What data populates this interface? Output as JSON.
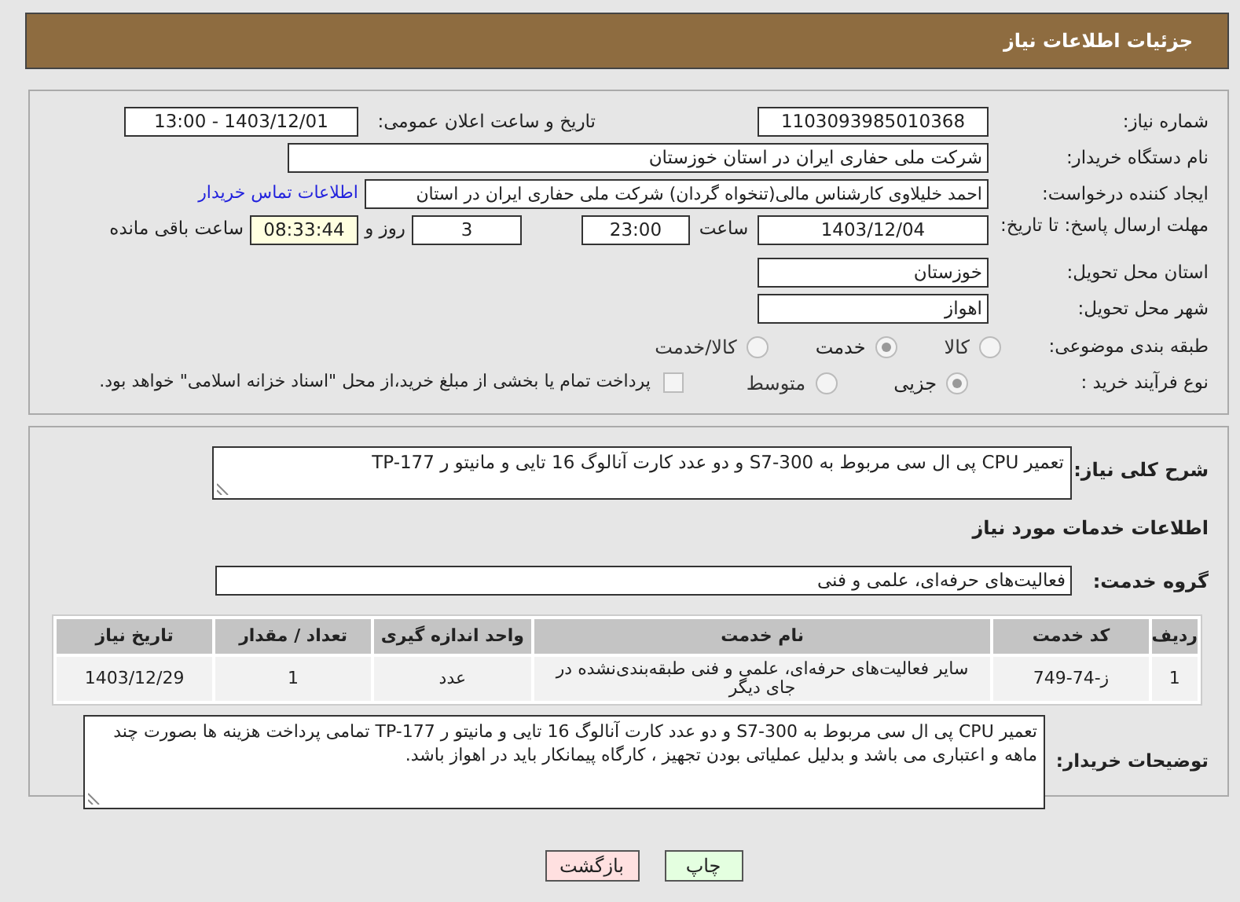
{
  "page_title": "جزئیات اطلاعات نیاز",
  "need_number": {
    "label": "شماره نیاز:",
    "value": "1103093985010368"
  },
  "announce_datetime": {
    "label": "تاریخ و ساعت اعلان عمومی:",
    "value": "1403/12/01 - 13:00"
  },
  "buyer_org": {
    "label": "نام دستگاه خریدار:",
    "value": "شرکت ملی حفاری ایران در استان خوزستان"
  },
  "requester": {
    "label": "ایجاد کننده درخواست:",
    "value": "احمد خلیلاوی کارشناس مالی(تنخواه گردان) شرکت ملی حفاری ایران در استان",
    "link": "اطلاعات تماس خریدار"
  },
  "deadline": {
    "label": "مهلت ارسال پاسخ: تا تاریخ:",
    "date": "1403/12/04",
    "time_label": "ساعت",
    "time": "23:00",
    "days": "3",
    "days_label": "روز و",
    "remaining": "08:33:44",
    "remaining_label": "ساعت باقی مانده"
  },
  "delivery_province": {
    "label": "استان محل تحویل:",
    "value": "خوزستان"
  },
  "delivery_city": {
    "label": "شهر محل تحویل:",
    "value": "اهواز"
  },
  "category": {
    "label": "طبقه بندی موضوعی:",
    "options": [
      {
        "label": "کالا",
        "selected": false
      },
      {
        "label": "خدمت",
        "selected": true
      },
      {
        "label": "کالا/خدمت",
        "selected": false
      }
    ]
  },
  "purchase_type": {
    "label": "نوع فرآیند خرید :",
    "options": [
      {
        "label": "جزیی",
        "selected": true
      },
      {
        "label": "متوسط",
        "selected": false
      }
    ],
    "treasury": {
      "label": "پرداخت تمام یا بخشی از مبلغ خرید،از محل \"اسناد خزانه اسلامی\" خواهد بود.",
      "checked": false
    }
  },
  "general_description": {
    "label": "شرح کلی نیاز:",
    "value": "تعمیر  CPU پی ال سی مربوط به S7-300 و دو عدد کارت آنالوگ 16 تایی و مانیتو ر TP-177"
  },
  "services_heading": "اطلاعات خدمات مورد نیاز",
  "service_group": {
    "label": "گروه خدمت:",
    "value": "فعالیت‌های حرفه‌ای، علمی و فنی"
  },
  "table": {
    "columns": [
      "ردیف",
      "کد خدمت",
      "نام خدمت",
      "واحد اندازه گیری",
      "تعداد / مقدار",
      "تاریخ نیاز"
    ],
    "rows": [
      [
        "1",
        "ز-74-749",
        "سایر فعالیت‌های حرفه‌ای، علمی و فنی طبقه‌بندی‌نشده در جای دیگر",
        "عدد",
        "1",
        "1403/12/29"
      ]
    ]
  },
  "buyer_notes": {
    "label": "توضیحات خریدار:",
    "value": "تعمیر  CPU پی ال سی مربوط به S7-300 و دو عدد کارت آنالوگ 16 تایی و مانیتو ر TP-177   تمامی پرداخت هزینه ها بصورت چند ماهه و اعتباری می باشد و بدلیل عملیاتی بودن تجهیز ، کارگاه پیمانکار باید در اهواز باشد."
  },
  "buttons": [
    {
      "label": "چاپ",
      "kind": "print"
    },
    {
      "label": "بازگشت",
      "kind": "back"
    }
  ]
}
